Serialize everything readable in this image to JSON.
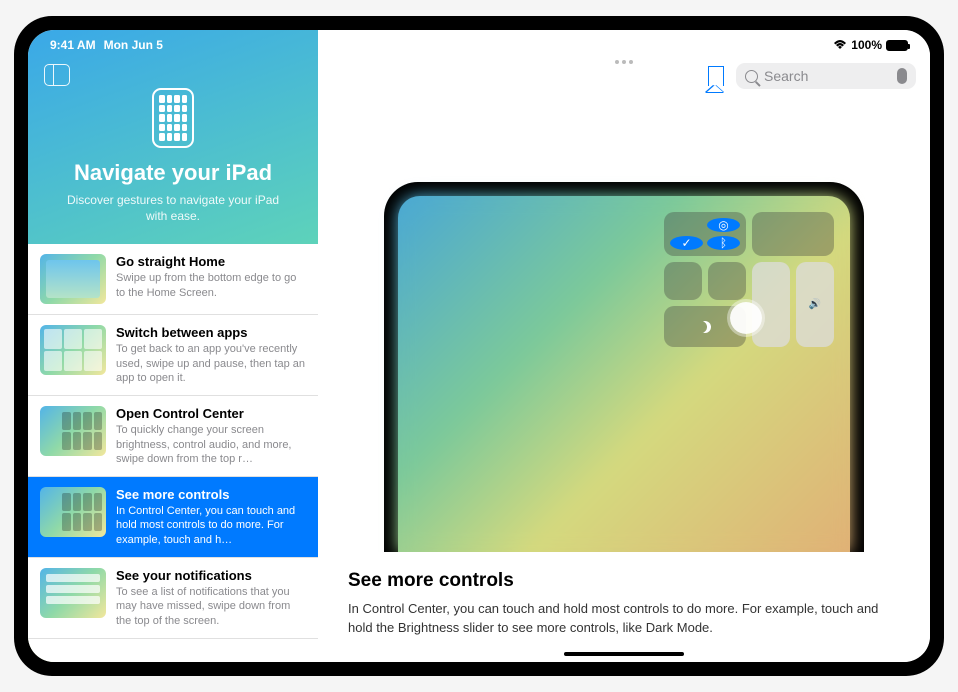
{
  "status": {
    "time": "9:41 AM",
    "date": "Mon Jun 5",
    "battery_pct": "100%"
  },
  "sidebar": {
    "title": "Navigate your iPad",
    "subtitle": "Discover gestures to navigate your iPad with ease.",
    "items": [
      {
        "title": "Go straight Home",
        "desc": "Swipe up from the bottom edge to go to the Home Screen."
      },
      {
        "title": "Switch between apps",
        "desc": "To get back to an app you've recently used, swipe up and pause, then tap an app to open it."
      },
      {
        "title": "Open Control Center",
        "desc": "To quickly change your screen brightness, control audio, and more, swipe down from the top r…"
      },
      {
        "title": "See more controls",
        "desc": "In Control Center, you can touch and hold most controls to do more. For example, touch and h…"
      },
      {
        "title": "See your notifications",
        "desc": "To see a list of notifications that you may have missed, swipe down from the top of the screen."
      }
    ]
  },
  "toolbar": {
    "search_placeholder": "Search"
  },
  "article": {
    "title": "See more controls",
    "body": "In Control Center, you can touch and hold most controls to do more. For example, touch and hold the Brightness slider to see more controls, like Dark Mode."
  }
}
